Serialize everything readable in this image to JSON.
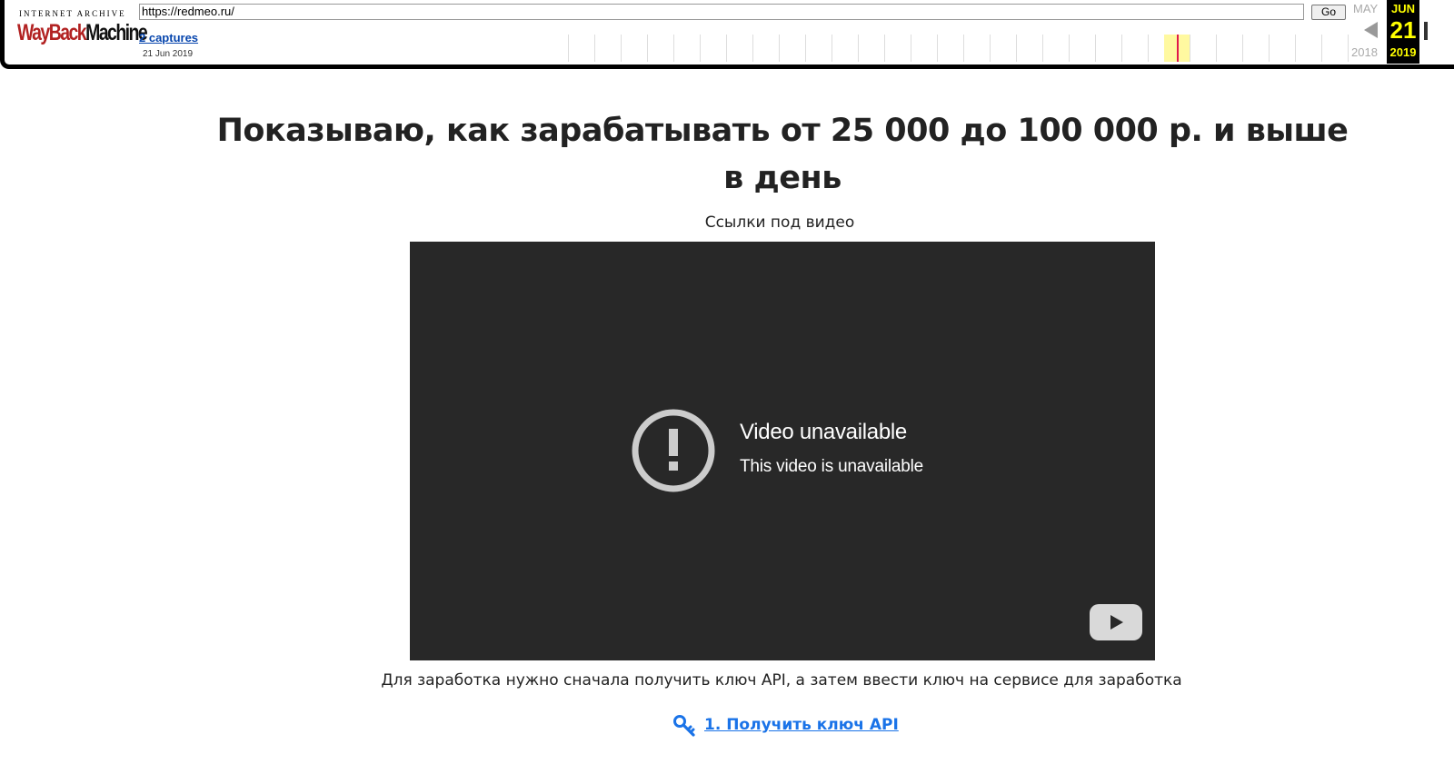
{
  "wayback": {
    "logo_top": "INTERNET ARCHIVE",
    "logo_wayback": "WayBack",
    "logo_machine": "Machine",
    "url_value": "https://redmeo.ru/",
    "go_label": "Go",
    "captures_label": "2 captures",
    "captures_date": "21 Jun 2019",
    "prev_month": "MAY",
    "prev_year": "2018",
    "current_month": "JUN",
    "current_day": "21",
    "current_year": "2019",
    "colors": {
      "highlight": "#fff9a0",
      "capture_mark": "#e0194b",
      "current_bg": "#000000",
      "current_text": "#ffff00"
    }
  },
  "page": {
    "title": "Показываю, как зарабатывать от 25 000 до 100 000 р. и выше в день",
    "subtitle": "Ссылки под видео",
    "video": {
      "error_title": "Video unavailable",
      "error_message": "This video is unavailable",
      "error_icon": "exclamation-circle-icon",
      "logo_icon": "youtube-play-icon",
      "background": "#282828"
    },
    "instructions": "Для заработка нужно сначала получить ключ API, а затем ввести ключ на сервисе для заработка",
    "api_link": {
      "icon": "key-icon",
      "label": "1. Получить ключ API",
      "color": "#1a73e8"
    }
  }
}
